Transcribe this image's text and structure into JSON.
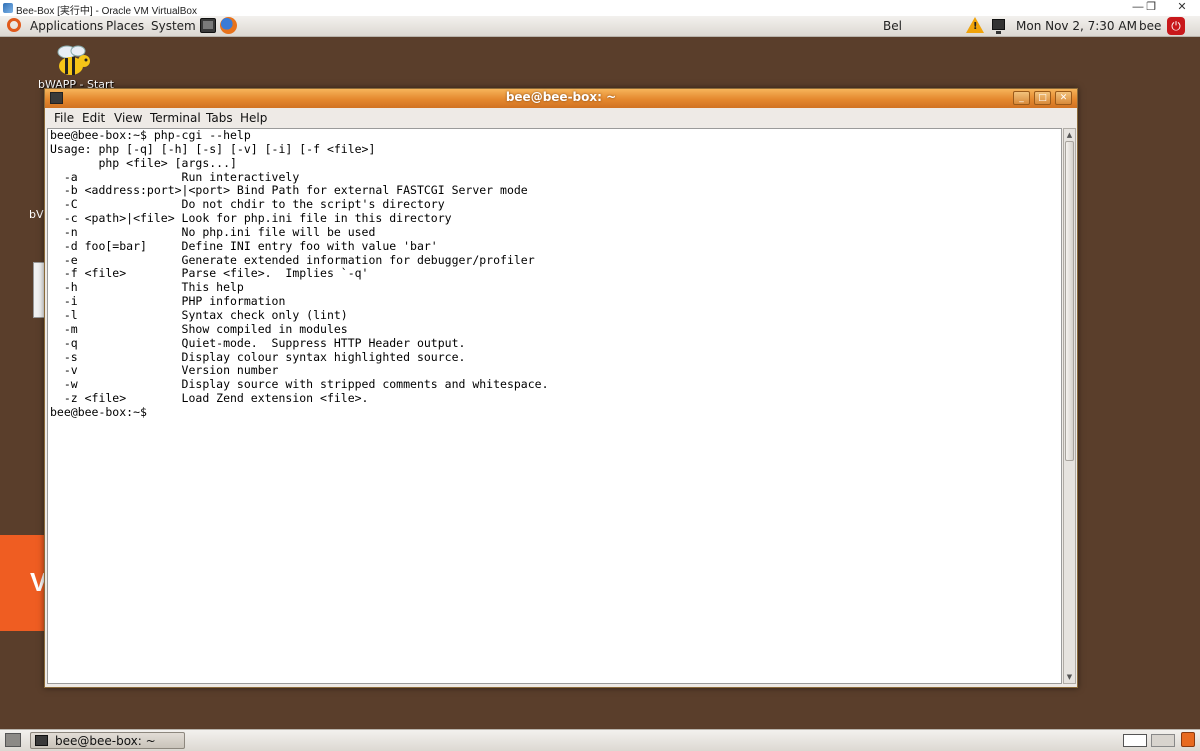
{
  "host_window": {
    "title": "Bee-Box [実行中] - Oracle VM VirtualBox",
    "minimize_glyph": "—",
    "restore_glyph": "❐",
    "close_glyph": "✕"
  },
  "top_panel": {
    "menus": [
      "Applications",
      "Places",
      "System"
    ],
    "keyboard_layout": "Bel",
    "clock": "Mon Nov  2,  7:30 AM",
    "user": "bee"
  },
  "desktop": {
    "icon_label": "bWAPP - Start",
    "partial_label": "bV",
    "banner_letter": "V"
  },
  "terminal": {
    "title": "bee@bee-box: ~",
    "menu": [
      "File",
      "Edit",
      "View",
      "Terminal",
      "Tabs",
      "Help"
    ],
    "lines": [
      "bee@bee-box:~$ php-cgi --help",
      "Usage: php [-q] [-h] [-s] [-v] [-i] [-f <file>]",
      "       php <file> [args...]",
      "  -a               Run interactively",
      "  -b <address:port>|<port> Bind Path for external FASTCGI Server mode",
      "  -C               Do not chdir to the script's directory",
      "  -c <path>|<file> Look for php.ini file in this directory",
      "  -n               No php.ini file will be used",
      "  -d foo[=bar]     Define INI entry foo with value 'bar'",
      "  -e               Generate extended information for debugger/profiler",
      "  -f <file>        Parse <file>.  Implies `-q'",
      "  -h               This help",
      "  -i               PHP information",
      "  -l               Syntax check only (lint)",
      "  -m               Show compiled in modules",
      "  -q               Quiet-mode.  Suppress HTTP Header output.",
      "  -s               Display colour syntax highlighted source.",
      "  -v               Version number",
      "  -w               Display source with stripped comments and whitespace.",
      "  -z <file>        Load Zend extension <file>.",
      "bee@bee-box:~$"
    ]
  },
  "taskbar": {
    "window_button_label": "bee@bee-box: ~"
  }
}
